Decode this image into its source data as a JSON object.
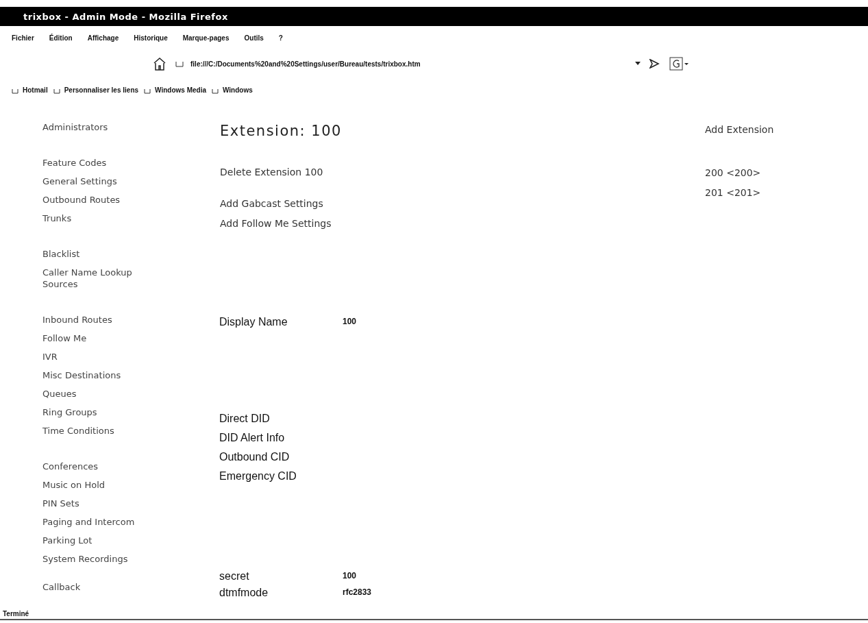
{
  "window": {
    "title": "trixbox - Admin Mode - Mozilla Firefox"
  },
  "menu": [
    "Fichier",
    "Édition",
    "Affichage",
    "Historique",
    "Marque-pages",
    "Outils",
    "?"
  ],
  "address": {
    "value": "file:///C:/Documents%20and%20Settings/user/Bureau/tests/trixbox.htm"
  },
  "bookmarks": [
    "Hotmail",
    "Personnaliser les liens",
    "Windows Media",
    "Windows"
  ],
  "sidebar": {
    "groups": [
      {
        "items": [
          "Administrators"
        ]
      },
      {
        "items": [
          "Feature Codes",
          "General Settings",
          "Outbound Routes",
          "Trunks"
        ]
      },
      {
        "items": [
          "Blacklist",
          "Caller Name Lookup Sources"
        ]
      },
      {
        "items": [
          "Inbound Routes",
          "Follow Me",
          "IVR",
          "Misc Destinations",
          "Queues",
          "Ring Groups",
          "Time Conditions"
        ]
      },
      {
        "items": [
          "Conferences",
          "Music on Hold",
          "PIN Sets",
          "Paging and Intercom",
          "Parking Lot",
          "System Recordings"
        ]
      },
      {
        "items": [
          "Callback"
        ]
      }
    ]
  },
  "main": {
    "heading": "Extension: 100",
    "links": [
      {
        "label": "Delete Extension 100",
        "kind": "single"
      },
      {
        "label": "Add Gabcast Settings",
        "kind": "pair"
      },
      {
        "label": "Add Follow Me Settings",
        "kind": "pair"
      }
    ],
    "field_groups": [
      {
        "fields": [
          {
            "label": "Display Name",
            "value": "100"
          }
        ]
      },
      {
        "fields": [
          {
            "label": "Direct DID"
          },
          {
            "label": "DID Alert Info"
          },
          {
            "label": "Outbound CID"
          },
          {
            "label": "Emergency CID"
          }
        ]
      },
      {
        "fields": [
          {
            "label": "secret",
            "value": "100"
          },
          {
            "label": "dtmfmode",
            "value": "rfc2833"
          }
        ]
      }
    ]
  },
  "extensions": {
    "add_label": "Add Extension",
    "items": [
      "200 <200>",
      "201 <201>"
    ]
  },
  "status_bar": {
    "text": "Terminé"
  }
}
